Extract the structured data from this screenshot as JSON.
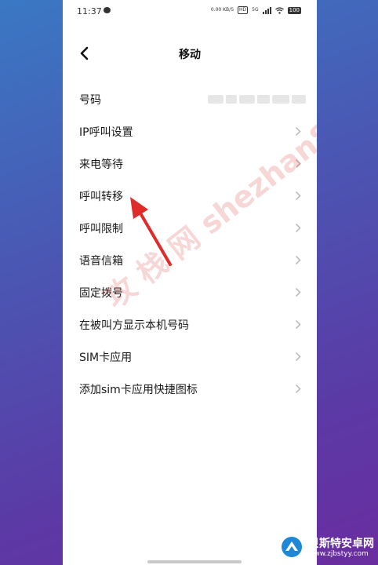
{
  "status_bar": {
    "time": "11:37",
    "network_speed": "0.00 KB/S",
    "hd_badge": "HD",
    "signal_label": "5G",
    "battery": "100"
  },
  "header": {
    "title": "移动",
    "back_icon": "chevron-left-icon"
  },
  "settings": [
    {
      "label": "号码",
      "value_masked": true
    },
    {
      "label": "IP呼叫设置"
    },
    {
      "label": "来电等待"
    },
    {
      "label": "呼叫转移"
    },
    {
      "label": "呼叫限制"
    },
    {
      "label": "语音信箱"
    },
    {
      "label": "固定拨号"
    },
    {
      "label": "在被叫方显示本机号码"
    },
    {
      "label": "SIM卡应用"
    },
    {
      "label": "添加sim卡应用快捷图标"
    }
  ],
  "watermark": "攻 栈 网  shezhan88.com",
  "site_logo": {
    "name": "贝斯特安卓网",
    "url": "www.zjbstyy.com"
  },
  "colors": {
    "background_gradient_start": "#3a78c4",
    "background_gradient_end": "#6a2da0",
    "annotation_arrow": "#e02b2b",
    "chevron": "#b5b5b5"
  }
}
